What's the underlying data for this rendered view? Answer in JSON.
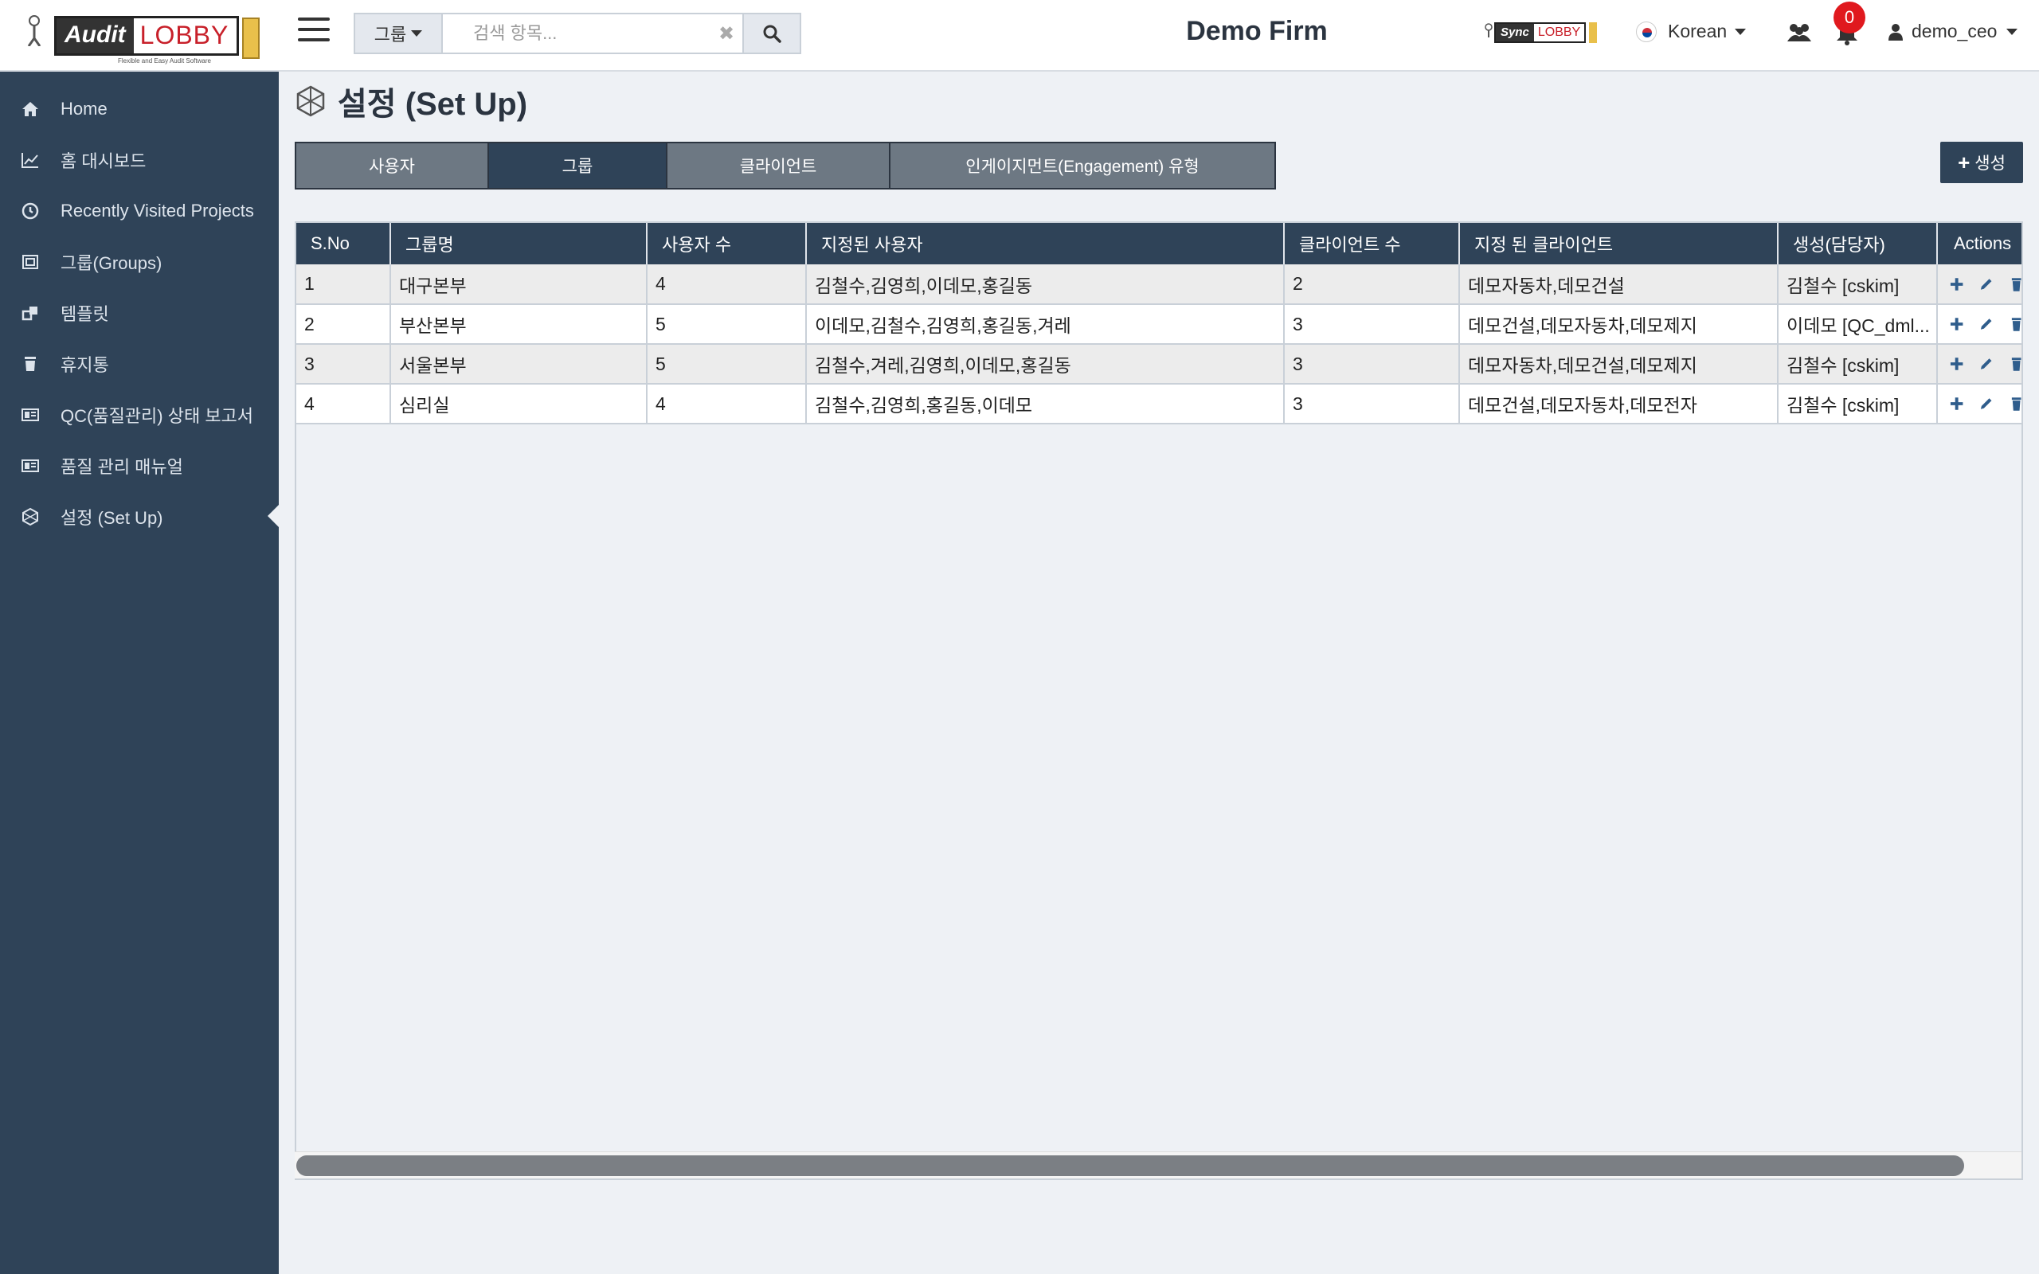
{
  "header": {
    "logo_text_audit": "Audit",
    "logo_text_lobby": "LOBBY",
    "logo_tagline": "Flexible and Easy Audit Software",
    "search_category": "그룹",
    "search_placeholder": "검색 항목...",
    "firm_name": "Demo Firm",
    "sync_logo_a": "Sync",
    "sync_logo_b": "LOBBY",
    "language": "Korean",
    "notification_count": "0",
    "username": "demo_ceo"
  },
  "sidebar": {
    "items": [
      {
        "label": "Home",
        "icon": "home-icon"
      },
      {
        "label": "홈 대시보드",
        "icon": "chart-line-icon"
      },
      {
        "label": "Recently Visited Projects",
        "icon": "clock-icon"
      },
      {
        "label": "그룹(Groups)",
        "icon": "groups-icon"
      },
      {
        "label": "템플릿",
        "icon": "template-icon"
      },
      {
        "label": "휴지통",
        "icon": "trash-icon"
      },
      {
        "label": "QC(품질관리) 상태 보고서",
        "icon": "report-icon"
      },
      {
        "label": "품질 관리 매뉴얼",
        "icon": "manual-icon"
      },
      {
        "label": "설정 (Set Up)",
        "icon": "setup-icon"
      }
    ],
    "active_index": 8
  },
  "main": {
    "title": "설정 (Set Up)",
    "tabs": [
      {
        "label": "사용자"
      },
      {
        "label": "그룹"
      },
      {
        "label": "클라이언트"
      },
      {
        "label": "인게이지먼트(Engagement) 유형"
      }
    ],
    "active_tab": 1,
    "create_label": "생성",
    "table": {
      "columns": [
        "S.No",
        "그룹명",
        "사용자 수",
        "지정된 사용자",
        "클라이언트 수",
        "지정 된 클라이언트",
        "생성(담당자)",
        "Actions"
      ],
      "rows": [
        [
          "1",
          "대구본부",
          "4",
          "김철수,김영희,이데모,홍길동",
          "2",
          "데모자동차,데모건설",
          "김철수 [cskim]"
        ],
        [
          "2",
          "부산본부",
          "5",
          "이데모,김철수,김영희,홍길동,겨레",
          "3",
          "데모건설,데모자동차,데모제지",
          "이데모 [QC_dml..."
        ],
        [
          "3",
          "서울본부",
          "5",
          "김철수,겨레,김영희,이데모,홍길동",
          "3",
          "데모자동차,데모건설,데모제지",
          "김철수 [cskim]"
        ],
        [
          "4",
          "심리실",
          "4",
          "김철수,김영희,홍길동,이데모",
          "3",
          "데모건설,데모자동차,데모전자",
          "김철수 [cskim]"
        ]
      ]
    }
  },
  "colors": {
    "sidebar_bg": "#2f4358",
    "header_bg": "#ffffff",
    "active_tab": "#2f4358",
    "inactive_tab": "#6d7883",
    "badge": "#e0191e"
  }
}
